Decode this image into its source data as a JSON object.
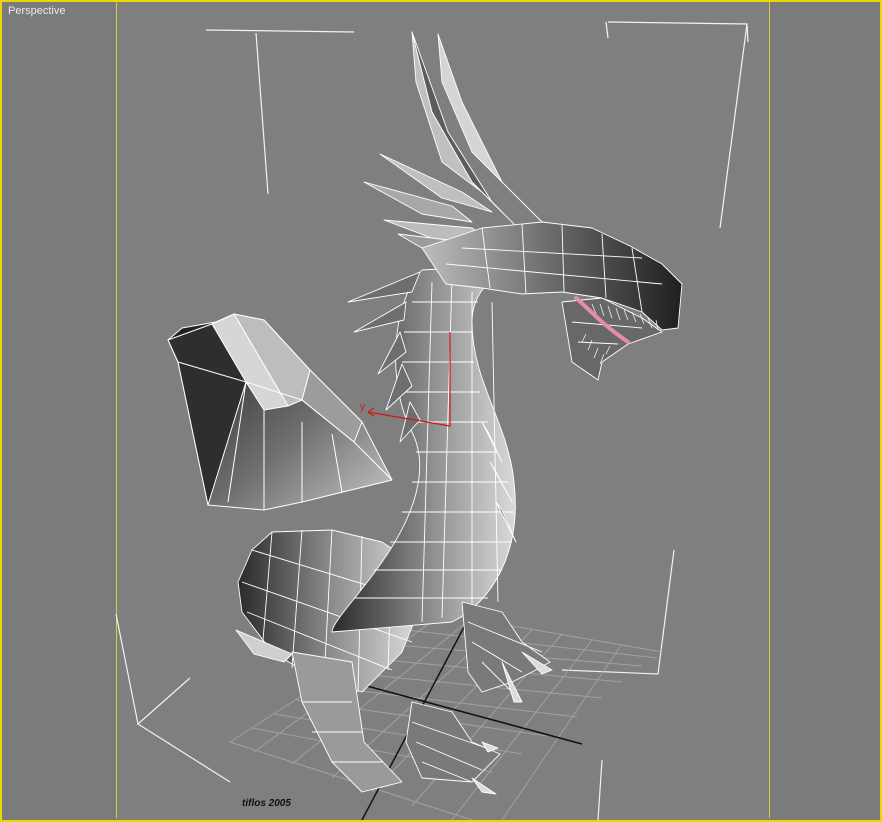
{
  "viewport": {
    "label": "Perspective",
    "border_color": "#e6d800",
    "background": "#7f7f7f"
  },
  "scene": {
    "credit": "tiflos 2005",
    "gizmo_axis_y": "y",
    "wire_color": "#ffffff",
    "tongue_color": "#e58bb0",
    "gizmo_color": "#d01818"
  }
}
